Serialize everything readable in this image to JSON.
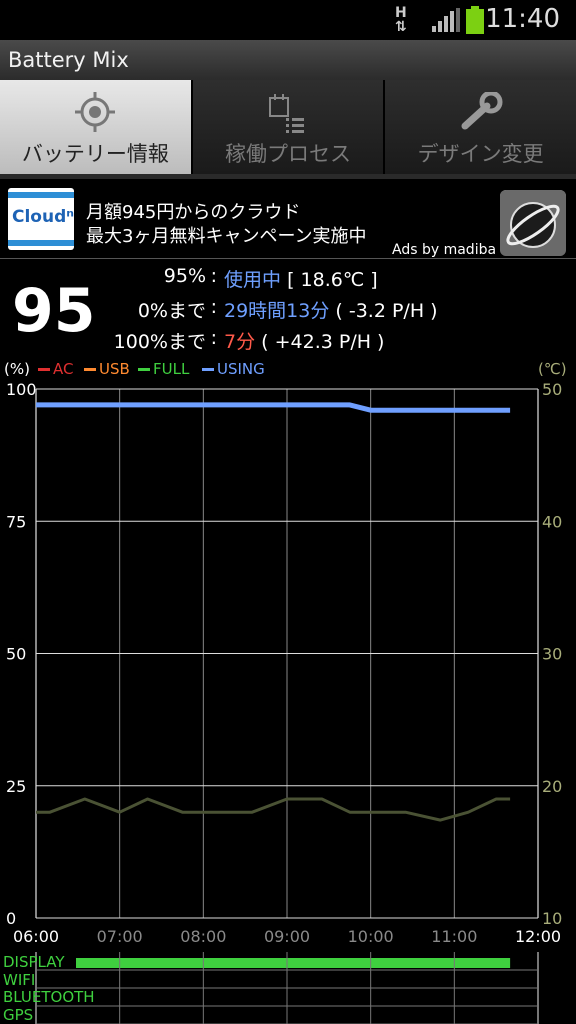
{
  "status": {
    "time": "11:40",
    "network_type": "H"
  },
  "app": {
    "title": "Battery Mix"
  },
  "tabs": [
    {
      "label": "バッテリー情報",
      "icon": "target-icon",
      "active": true
    },
    {
      "label": "稼働プロセス",
      "icon": "process-list-icon",
      "active": false
    },
    {
      "label": "デザイン変更",
      "icon": "wrench-icon",
      "active": false
    }
  ],
  "ad": {
    "logo_text": "Cloudⁿ",
    "line1": "月額945円からのクラウド",
    "line2": "最大3ヶ月無料キャンペーン実施中",
    "byline": "Ads by madiba"
  },
  "battery": {
    "level": "95",
    "row1_label": "95%",
    "row1_status": "使用中",
    "row1_temp": "[ 18.6℃ ]",
    "row2_label": "0%まで",
    "row2_time": "29時間13分",
    "row2_rate": "( -3.2 P/H )",
    "row3_label": "100%まで",
    "row3_time": "7分",
    "row3_rate": "( +42.3 P/H )"
  },
  "legend": {
    "left_unit": "(%)",
    "right_unit": "(℃)",
    "items": [
      {
        "label": "AC",
        "color": "#e03030"
      },
      {
        "label": "USB",
        "color": "#ff8a30"
      },
      {
        "label": "FULL",
        "color": "#40d040"
      },
      {
        "label": "USING",
        "color": "#6f9fff"
      }
    ]
  },
  "chart_data": {
    "type": "line",
    "x_ticks": [
      "06:00",
      "07:00",
      "08:00",
      "09:00",
      "10:00",
      "11:00",
      "12:00"
    ],
    "y_left_ticks": [
      "100",
      "75",
      "50",
      "25",
      "0"
    ],
    "y_right_ticks": [
      "50",
      "40",
      "30",
      "20",
      "10"
    ],
    "ylim_left": [
      0,
      100
    ],
    "ylim_right": [
      10,
      50
    ],
    "grid": true,
    "series": [
      {
        "name": "USING",
        "axis": "left",
        "color": "#6f9fff",
        "points": [
          [
            "06:00",
            97
          ],
          [
            "09:45",
            97
          ],
          [
            "10:00",
            96
          ],
          [
            "11:40",
            96
          ]
        ]
      },
      {
        "name": "temperature",
        "axis": "right",
        "color": "#4a5234",
        "points": [
          [
            "06:00",
            18
          ],
          [
            "06:10",
            18
          ],
          [
            "06:35",
            19
          ],
          [
            "07:00",
            18
          ],
          [
            "07:20",
            19
          ],
          [
            "07:45",
            18
          ],
          [
            "08:35",
            18
          ],
          [
            "09:00",
            19
          ],
          [
            "09:25",
            19
          ],
          [
            "09:45",
            18
          ],
          [
            "10:25",
            18
          ],
          [
            "10:50",
            17.4
          ],
          [
            "11:10",
            18
          ],
          [
            "11:30",
            19
          ],
          [
            "11:40",
            19
          ]
        ]
      }
    ],
    "usage_rows": [
      {
        "label": "DISPLAY",
        "color": "#3fd03f",
        "on_from": "06:30",
        "on_to": "11:40"
      },
      {
        "label": "WIFI",
        "color": "#3fd03f"
      },
      {
        "label": "BLUETOOTH",
        "color": "#3fd03f"
      },
      {
        "label": "GPS",
        "color": "#3fd03f"
      }
    ]
  }
}
